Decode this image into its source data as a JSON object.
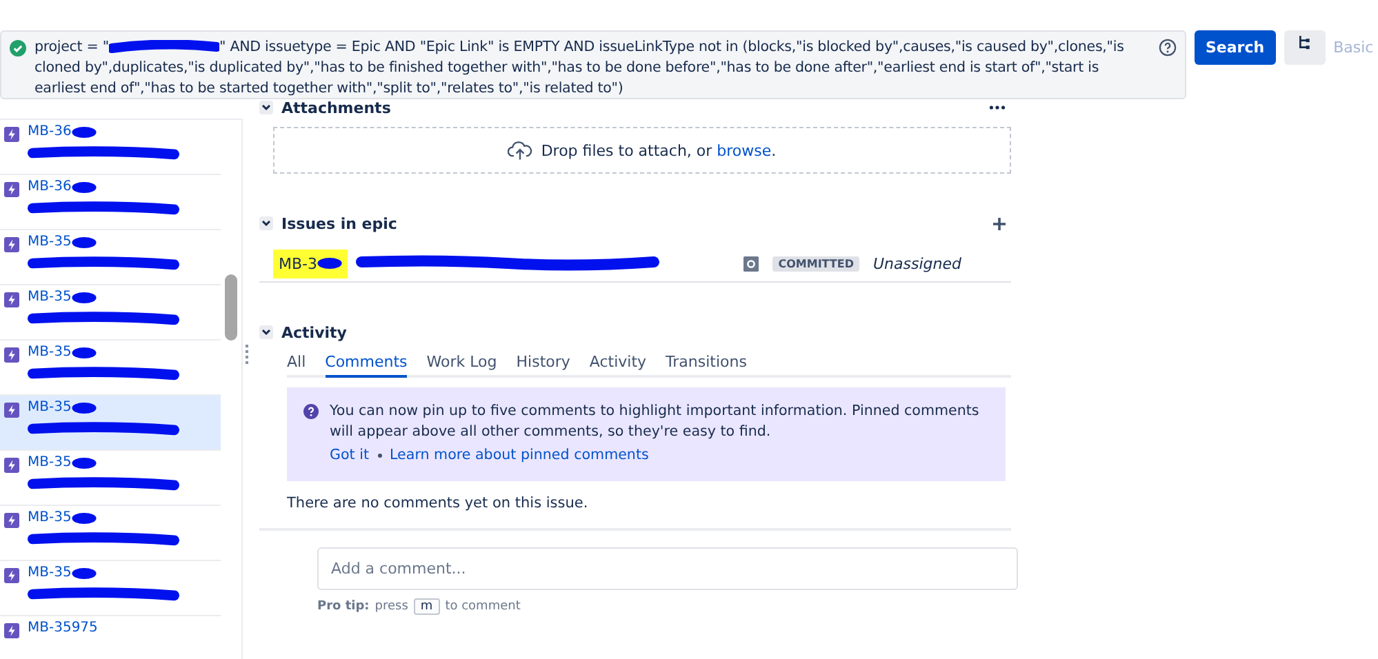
{
  "query": {
    "start": "project = \"",
    "rest": "\" AND issuetype = Epic AND \"Epic Link\" is EMPTY AND issueLinkType not in (blocks,\"is blocked by\",causes,\"is caused by\",clones,\"is cloned by\",duplicates,\"is duplicated by\",\"has to be finished together with\",\"has to be done before\",\"has to be done after\",\"earliest end is start of\",\"start is earliest end of\",\"has to be started together with\",\"split to\",\"relates to\",\"is related to\")"
  },
  "search_button": "Search",
  "basic_link": "Basic",
  "issues": [
    {
      "key": "MB-36",
      "selected": false
    },
    {
      "key": "MB-36",
      "selected": false
    },
    {
      "key": "MB-35",
      "selected": false
    },
    {
      "key": "MB-35",
      "selected": false
    },
    {
      "key": "MB-35",
      "selected": false
    },
    {
      "key": "MB-35",
      "selected": true
    },
    {
      "key": "MB-35",
      "selected": false
    },
    {
      "key": "MB-35",
      "selected": false
    },
    {
      "key": "MB-35",
      "selected": false
    },
    {
      "key": "MB-35975",
      "selected": false
    }
  ],
  "attachments": {
    "title": "Attachments",
    "drop_text": "Drop files to attach, or ",
    "browse_link": "browse",
    "after": "."
  },
  "epic": {
    "title": "Issues in epic",
    "key": "MB-3",
    "status": "COMMITTED",
    "assignee": "Unassigned"
  },
  "activity": {
    "title": "Activity",
    "tabs": [
      {
        "label": "All",
        "selected": false
      },
      {
        "label": "Comments",
        "selected": true
      },
      {
        "label": "Work Log",
        "selected": false
      },
      {
        "label": "History",
        "selected": false
      },
      {
        "label": "Activity",
        "selected": false
      },
      {
        "label": "Transitions",
        "selected": false
      }
    ],
    "info": "You can now pin up to five comments to highlight important information. Pinned comments will appear above all other comments, so they're easy to find.",
    "got_it": "Got it",
    "learn_more": "Learn more about pinned comments",
    "empty": "There are no comments yet on this issue.",
    "comment_placeholder": "Add a comment...",
    "pro_tip_label": "Pro tip:",
    "pro_tip_press": "press",
    "pro_tip_key": "m",
    "pro_tip_end": "to comment"
  }
}
